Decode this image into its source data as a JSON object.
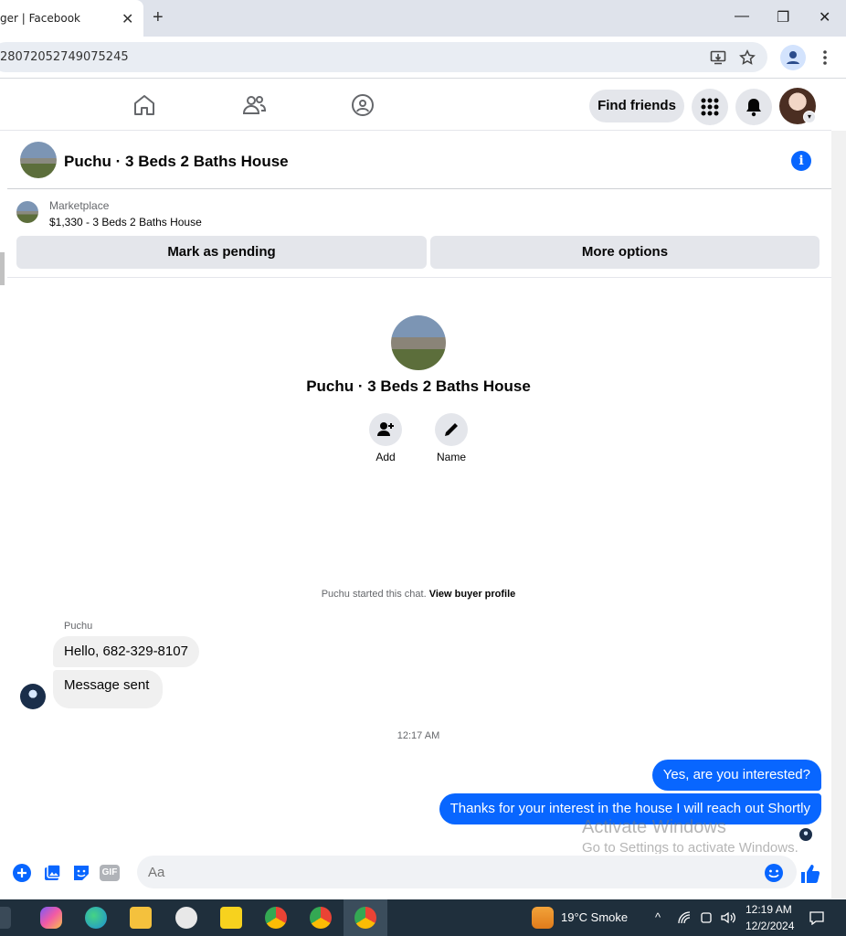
{
  "browser": {
    "tab_title": "ger | Facebook",
    "tab_close": "✕",
    "new_tab": "+",
    "url": "28072052749075245",
    "window_min": "—",
    "window_restore": "❐",
    "window_close": "✕"
  },
  "fbnav": {
    "find_friends": "Find friends",
    "icons": [
      "home-icon",
      "friends-icon",
      "groups-icon",
      "menu-grid-icon",
      "notifications-icon"
    ]
  },
  "chat_header": {
    "title": "Puchu · 3 Beds 2 Baths House",
    "info": "i"
  },
  "marketplace": {
    "label": "Marketplace",
    "item": "$1,330 - 3 Beds 2 Baths House",
    "mark_pending": "Mark as pending",
    "more_options": "More options"
  },
  "conversation": {
    "title": "Puchu · 3 Beds 2 Baths House",
    "add_label": "Add",
    "name_label": "Name",
    "started_text": "Puchu started this chat. ",
    "view_buyer": "View buyer profile",
    "sender_name": "Puchu",
    "incoming": [
      "Hello, 682-329-8107",
      "Message sent"
    ],
    "timestamp": "12:17 AM",
    "outgoing": [
      "Yes, are you interested?",
      "Thanks for your interest in the house I will reach out Shortly"
    ]
  },
  "watermark": {
    "line1": "Activate Windows",
    "line2": "Go to Settings to activate Windows."
  },
  "composer": {
    "placeholder": "Aa",
    "gif": "GIF"
  },
  "taskbar": {
    "weather": "19°C  Smoke",
    "time": "12:19 AM",
    "date": "12/2/2024"
  },
  "colors": {
    "accent": "#0866ff",
    "bubble_in": "#f0f0f0",
    "taskbar": "#1f2f3c"
  }
}
